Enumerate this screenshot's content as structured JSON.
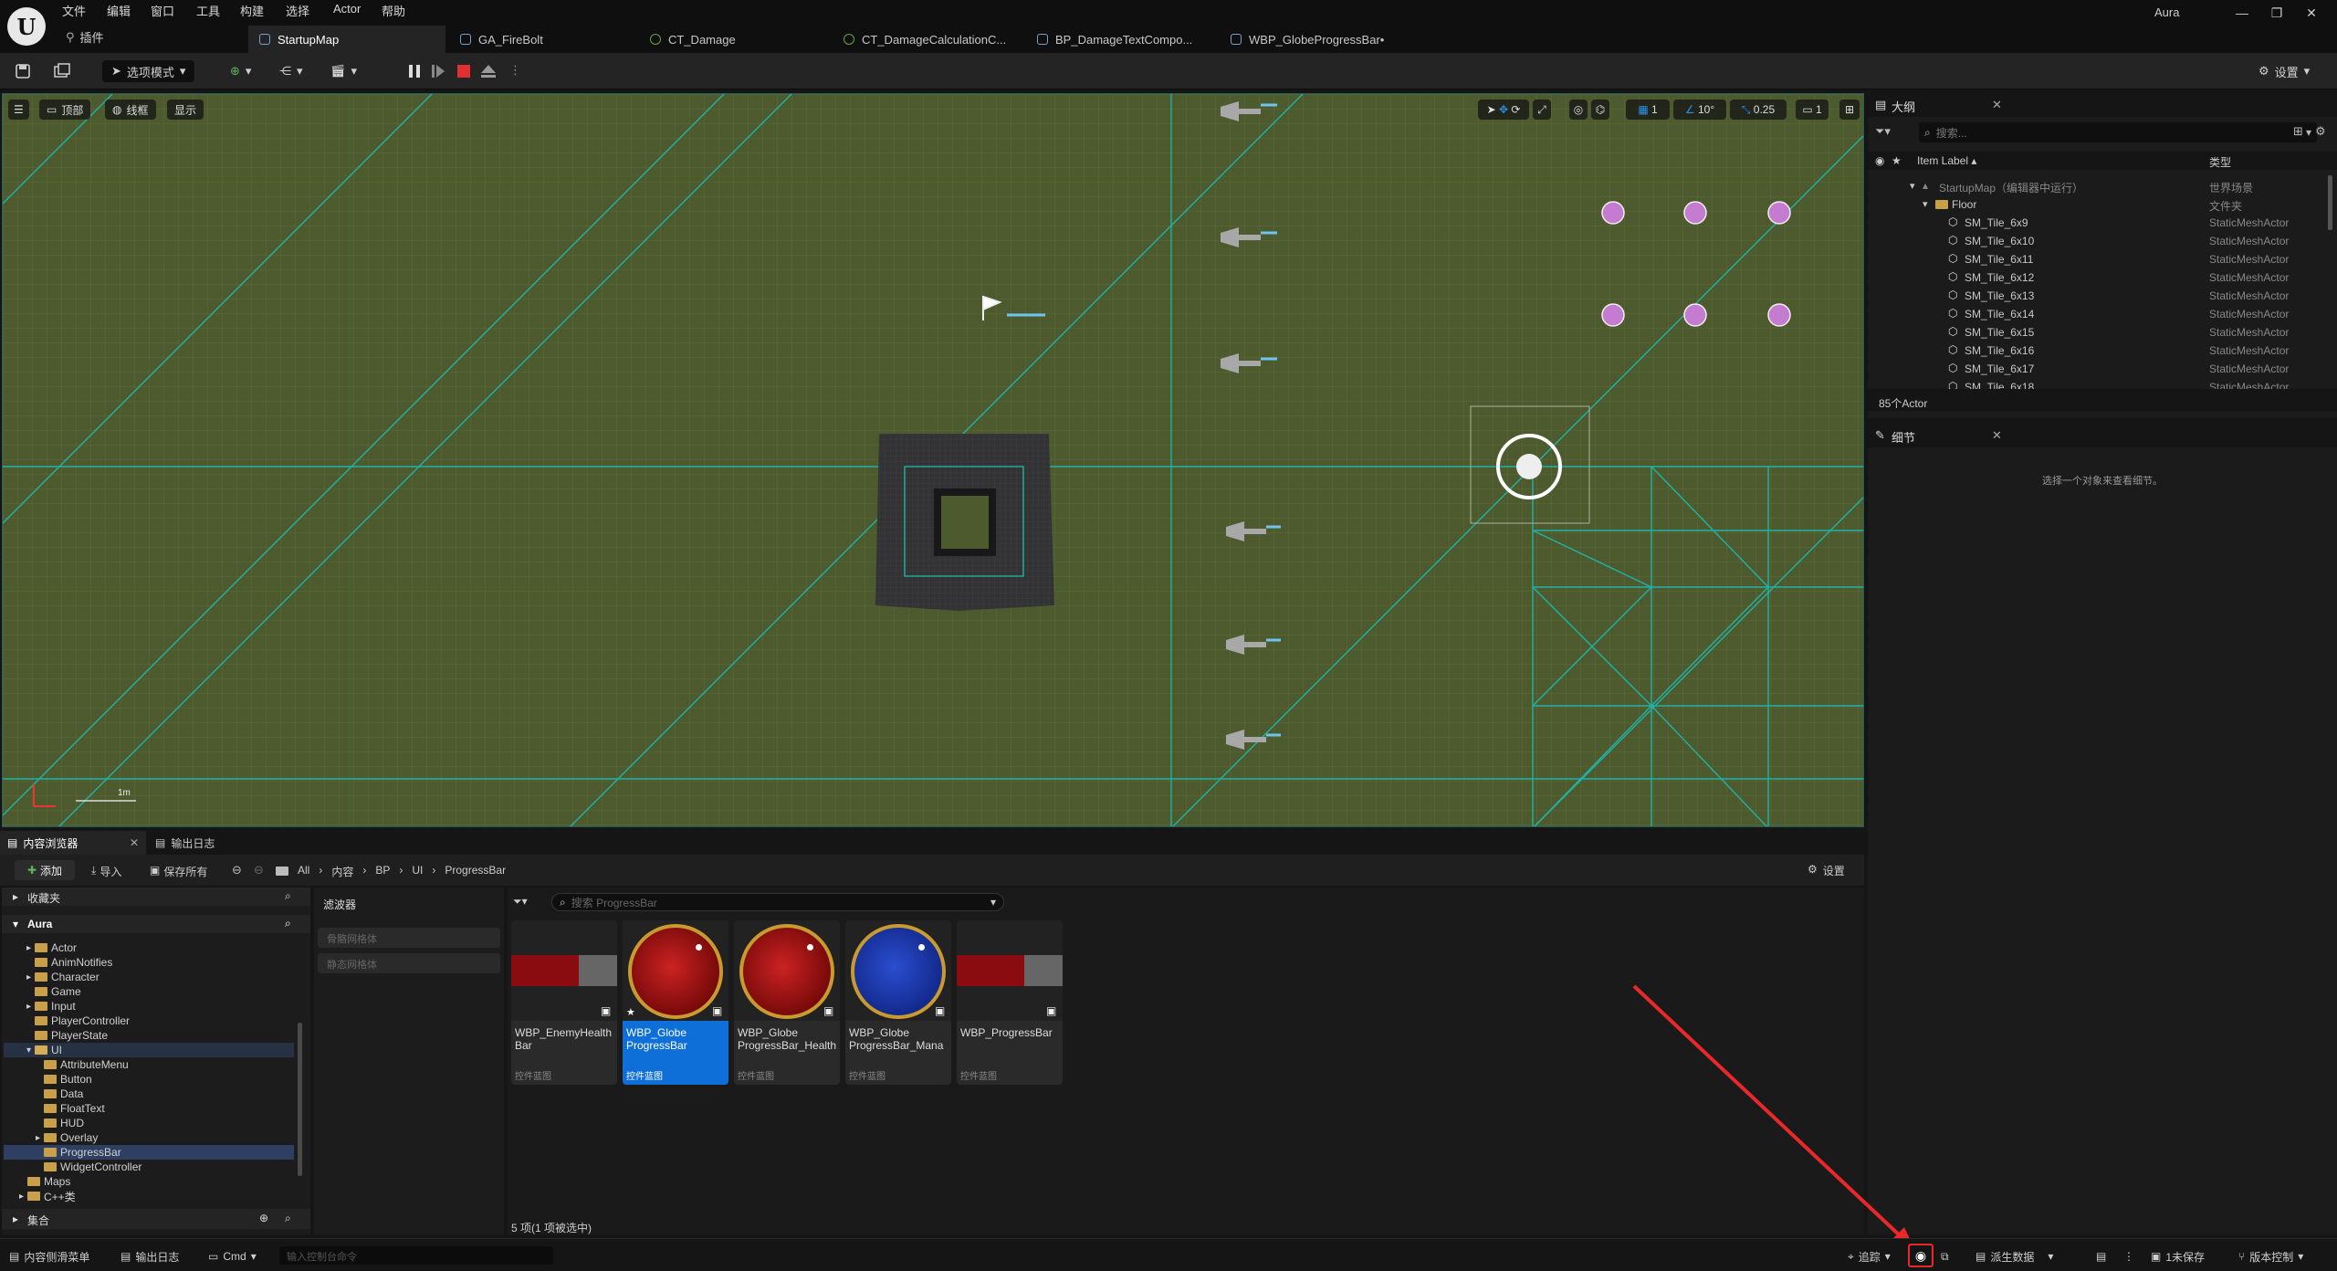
{
  "menu": [
    "文件",
    "编辑",
    "窗口",
    "工具",
    "构建",
    "选择",
    "Actor",
    "帮助"
  ],
  "plugin_label": "插件",
  "project_name": "Aura",
  "tabs": [
    {
      "label": "StartupMap",
      "active": true
    },
    {
      "label": "GA_FireBolt"
    },
    {
      "label": "CT_Damage"
    },
    {
      "label": "CT_DamageCalculationC..."
    },
    {
      "label": "BP_DamageTextCompo..."
    },
    {
      "label": "WBP_GlobeProgressBar•"
    }
  ],
  "toolbar": {
    "mode_label": "选项模式",
    "settings_label": "设置"
  },
  "viewport": {
    "view_btn": "顶部",
    "wire_btn": "线框",
    "show_btn": "显示",
    "grid_value": "1",
    "angle_value": "10°",
    "scale_value": "0.25",
    "cam_value": "1",
    "scale_label": "1m"
  },
  "outliner": {
    "title": "大纲",
    "search_placeholder": "搜索...",
    "col_label": "Item Label ▴",
    "col_type": "类型",
    "rows": [
      {
        "label": "StartupMap（编辑器中运行）",
        "type": "世界场景",
        "indent": 1,
        "kind": "map"
      },
      {
        "label": "Floor",
        "type": "文件夹",
        "indent": 2,
        "kind": "folder"
      },
      {
        "label": "SM_Tile_6x9",
        "type": "StaticMeshActor",
        "indent": 3,
        "kind": "mesh"
      },
      {
        "label": "SM_Tile_6x10",
        "type": "StaticMeshActor",
        "indent": 3,
        "kind": "mesh"
      },
      {
        "label": "SM_Tile_6x11",
        "type": "StaticMeshActor",
        "indent": 3,
        "kind": "mesh"
      },
      {
        "label": "SM_Tile_6x12",
        "type": "StaticMeshActor",
        "indent": 3,
        "kind": "mesh"
      },
      {
        "label": "SM_Tile_6x13",
        "type": "StaticMeshActor",
        "indent": 3,
        "kind": "mesh"
      },
      {
        "label": "SM_Tile_6x14",
        "type": "StaticMeshActor",
        "indent": 3,
        "kind": "mesh"
      },
      {
        "label": "SM_Tile_6x15",
        "type": "StaticMeshActor",
        "indent": 3,
        "kind": "mesh"
      },
      {
        "label": "SM_Tile_6x16",
        "type": "StaticMeshActor",
        "indent": 3,
        "kind": "mesh"
      },
      {
        "label": "SM_Tile_6x17",
        "type": "StaticMeshActor",
        "indent": 3,
        "kind": "mesh"
      },
      {
        "label": "SM_Tile_6x18",
        "type": "StaticMeshActor",
        "indent": 3,
        "kind": "mesh"
      }
    ],
    "count": "85个Actor"
  },
  "details": {
    "title": "细节",
    "empty_text": "选择一个对象来查看细节。"
  },
  "content_browser": {
    "tab_label": "内容浏览器",
    "log_tab": "输出日志",
    "add_label": "添加",
    "import_label": "导入",
    "save_all_label": "保存所有",
    "breadcrumb": [
      "All",
      "内容",
      "BP",
      "UI",
      "ProgressBar"
    ],
    "settings_label": "设置",
    "favorites_label": "收藏夹",
    "root_label": "Aura",
    "tree": [
      {
        "label": "Actor",
        "depth": 1,
        "arrow": true
      },
      {
        "label": "AnimNotifies",
        "depth": 1
      },
      {
        "label": "Character",
        "depth": 1,
        "arrow": true
      },
      {
        "label": "Game",
        "depth": 1
      },
      {
        "label": "Input",
        "depth": 1,
        "arrow": true
      },
      {
        "label": "PlayerController",
        "depth": 1
      },
      {
        "label": "PlayerState",
        "depth": 1
      },
      {
        "label": "UI",
        "depth": 1,
        "open": true
      },
      {
        "label": "AttributeMenu",
        "depth": 2
      },
      {
        "label": "Button",
        "depth": 2
      },
      {
        "label": "Data",
        "depth": 2
      },
      {
        "label": "FloatText",
        "depth": 2
      },
      {
        "label": "HUD",
        "depth": 2
      },
      {
        "label": "Overlay",
        "depth": 2,
        "arrow": true
      },
      {
        "label": "ProgressBar",
        "depth": 2,
        "selected": true
      },
      {
        "label": "WidgetController",
        "depth": 2
      },
      {
        "label": "Maps",
        "depth": 0
      },
      {
        "label": "C++类",
        "depth": 0,
        "arrow": true
      }
    ],
    "collections_label": "集合",
    "filters_title": "滤波器",
    "filters": [
      "骨骼网格体",
      "静态网格体"
    ],
    "search_placeholder": "搜索 ProgressBar",
    "assets": [
      {
        "name": "WBP_EnemyHealth Bar",
        "type": "控件蓝图",
        "thumb": "bar"
      },
      {
        "name": "WBP_Globe ProgressBar",
        "type": "控件蓝图",
        "thumb": "red",
        "selected": true
      },
      {
        "name": "WBP_Globe ProgressBar_Health",
        "type": "控件蓝图",
        "thumb": "red"
      },
      {
        "name": "WBP_Globe ProgressBar_Mana",
        "type": "控件蓝图",
        "thumb": "blue"
      },
      {
        "name": "WBP_ProgressBar",
        "type": "控件蓝图",
        "thumb": "bar"
      }
    ],
    "item_count": "5 项(1 项被选中)"
  },
  "statusbar": {
    "drawer": "内容侧滑菜单",
    "log": "输出日志",
    "cmd": "Cmd",
    "console_placeholder": "输入控制台命令",
    "trace": "追踪",
    "derived": "派生数据",
    "unsaved": "1未保存",
    "source_control": "版本控制"
  },
  "colors": {
    "accent": "#0e6fd8",
    "annotation": "#e8282a",
    "viewport_bg": "#4d5a2e",
    "grid_line": "#1fb5a8"
  }
}
